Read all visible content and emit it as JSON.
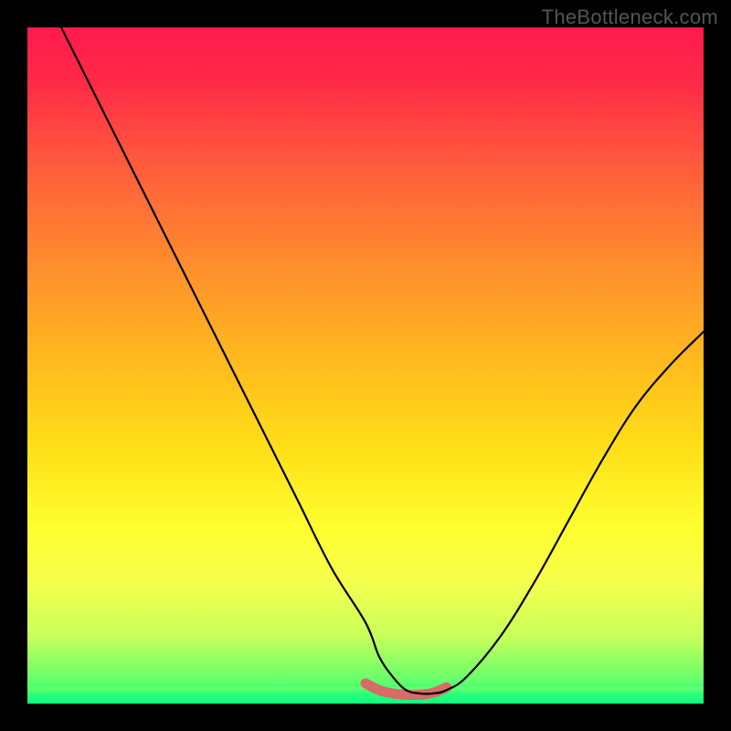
{
  "watermark": "TheBottleneck.com",
  "colors": {
    "gradient_top": "#ff1a4d",
    "gradient_mid": "#ffde17",
    "gradient_bottom": "#0aff7e",
    "curve": "#000000",
    "valley_marker": "#d86a68",
    "frame": "#000000"
  },
  "chart_data": {
    "type": "line",
    "title": "",
    "xlabel": "",
    "ylabel": "",
    "xlim": [
      0,
      100
    ],
    "ylim": [
      0,
      100
    ],
    "grid": false,
    "legend": false,
    "series": [
      {
        "name": "bottleneck-curve",
        "x": [
          5,
          10,
          15,
          20,
          25,
          30,
          35,
          40,
          45,
          50,
          52,
          54,
          56,
          58,
          60,
          62,
          65,
          70,
          75,
          80,
          85,
          90,
          95,
          100
        ],
        "y": [
          100,
          90,
          80,
          70,
          60,
          50,
          40,
          30,
          20,
          12,
          7,
          4,
          2,
          1.5,
          1.5,
          2,
          4,
          10,
          18,
          27,
          36,
          44,
          50,
          55
        ]
      },
      {
        "name": "valley-marker",
        "x": [
          50,
          52,
          54,
          56,
          58,
          60,
          62
        ],
        "y": [
          3,
          2,
          1.5,
          1.3,
          1.3,
          1.6,
          2.4
        ]
      }
    ],
    "notes": "V-shaped curve on a vertical red-to-green gradient; minimum (no bottleneck) occurs around x≈57. Values are visual estimates — the image has no axis ticks or numeric labels."
  }
}
